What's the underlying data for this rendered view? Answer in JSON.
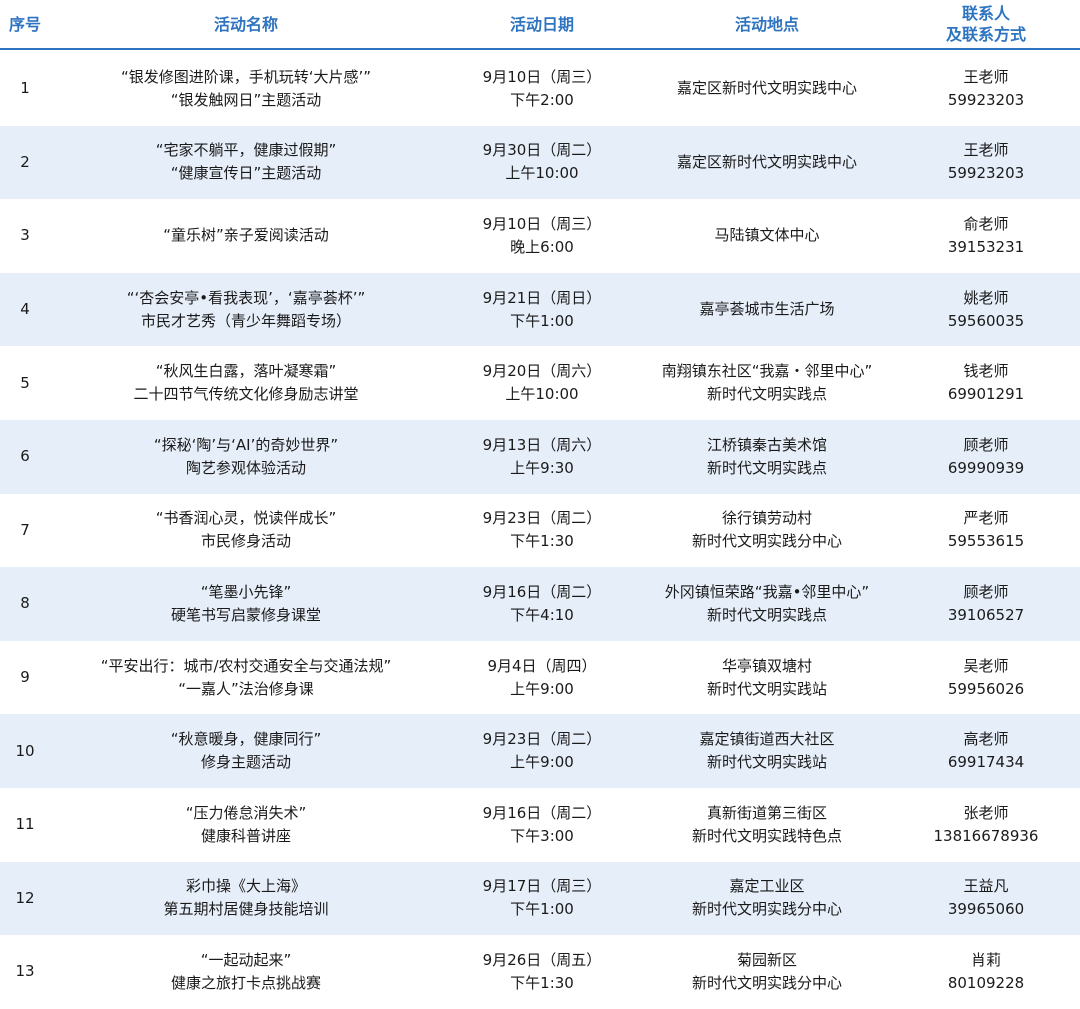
{
  "headers": {
    "no": "序号",
    "name": "活动名称",
    "date": "活动日期",
    "place": "活动地点",
    "contact_l1": "联系人",
    "contact_l2": "及联系方式"
  },
  "rows": [
    {
      "no": "1",
      "name1": "“银发修图进阶课，手机玩转‘大片感’”",
      "name2": "“银发触网日”主题活动",
      "date1": "9月10日（周三）",
      "date2": "下午2:00",
      "place1": "嘉定区新时代文明实践中心",
      "place2": "",
      "contact1": "王老师",
      "contact2": "59923203"
    },
    {
      "no": "2",
      "name1": "“宅家不躺平，健康过假期”",
      "name2": "“健康宣传日”主题活动",
      "date1": "9月30日（周二）",
      "date2": "上午10:00",
      "place1": "嘉定区新时代文明实践中心",
      "place2": "",
      "contact1": "王老师",
      "contact2": "59923203"
    },
    {
      "no": "3",
      "name1": "“童乐树”亲子爱阅读活动",
      "name2": "",
      "date1": "9月10日（周三）",
      "date2": "晚上6:00",
      "place1": "马陆镇文体中心",
      "place2": "",
      "contact1": "俞老师",
      "contact2": "39153231"
    },
    {
      "no": "4",
      "name1": "“‘杏会安亭•看我表现’，‘嘉亭荟杯’”",
      "name2": "市民才艺秀（青少年舞蹈专场）",
      "date1": "9月21日（周日）",
      "date2": "下午1:00",
      "place1": "嘉亭荟城市生活广场",
      "place2": "",
      "contact1": "姚老师",
      "contact2": "59560035"
    },
    {
      "no": "5",
      "name1": "“秋风生白露，落叶凝寒霜”",
      "name2": "二十四节气传统文化修身励志讲堂",
      "date1": "9月20日（周六）",
      "date2": "上午10:00",
      "place1": "南翔镇东社区“我嘉・邻里中心”",
      "place2": "新时代文明实践点",
      "contact1": "钱老师",
      "contact2": "69901291"
    },
    {
      "no": "6",
      "name1": "“探秘‘陶’与‘AI’的奇妙世界”",
      "name2": "陶艺参观体验活动",
      "date1": "9月13日（周六）",
      "date2": "上午9:30",
      "place1": "江桥镇秦古美术馆",
      "place2": "新时代文明实践点",
      "contact1": "顾老师",
      "contact2": "69990939"
    },
    {
      "no": "7",
      "name1": "“书香润心灵，悦读伴成长”",
      "name2": "市民修身活动",
      "date1": "9月23日（周二）",
      "date2": "下午1:30",
      "place1": "徐行镇劳动村",
      "place2": "新时代文明实践分中心",
      "contact1": "严老师",
      "contact2": "59553615"
    },
    {
      "no": "8",
      "name1": "“笔墨小先锋”",
      "name2": "硬笔书写启蒙修身课堂",
      "date1": "9月16日（周二）",
      "date2": "下午4:10",
      "place1": "外冈镇恒荣路“我嘉•邻里中心”",
      "place2": "新时代文明实践点",
      "contact1": "顾老师",
      "contact2": "39106527"
    },
    {
      "no": "9",
      "name1": "“平安出行：城市/农村交通安全与交通法规”",
      "name2": "“一嘉人”法治修身课",
      "date1": "9月4日（周四）",
      "date2": "上午9:00",
      "place1": "华亭镇双塘村",
      "place2": "新时代文明实践站",
      "contact1": "吴老师",
      "contact2": "59956026"
    },
    {
      "no": "10",
      "name1": "“秋意暖身，健康同行”",
      "name2": "修身主题活动",
      "date1": "9月23日（周二）",
      "date2": "上午9:00",
      "place1": "嘉定镇街道西大社区",
      "place2": "新时代文明实践站",
      "contact1": "高老师",
      "contact2": "69917434"
    },
    {
      "no": "11",
      "name1": "“压力倦怠消失术”",
      "name2": "健康科普讲座",
      "date1": "9月16日（周二）",
      "date2": "下午3:00",
      "place1": "真新街道第三街区",
      "place2": "新时代文明实践特色点",
      "contact1": "张老师",
      "contact2": "13816678936"
    },
    {
      "no": "12",
      "name1": "彩巾操《大上海》",
      "name2": "第五期村居健身技能培训",
      "date1": "9月17日（周三）",
      "date2": "下午1:00",
      "place1": "嘉定工业区",
      "place2": "新时代文明实践分中心",
      "contact1": "王益凡",
      "contact2": "39965060"
    },
    {
      "no": "13",
      "name1": "“一起动起来”",
      "name2": "健康之旅打卡点挑战赛",
      "date1": "9月26日（周五）",
      "date2": "下午1:30",
      "place1": "菊园新区",
      "place2": "新时代文明实践分中心",
      "contact1": "肖莉",
      "contact2": "80109228"
    }
  ]
}
